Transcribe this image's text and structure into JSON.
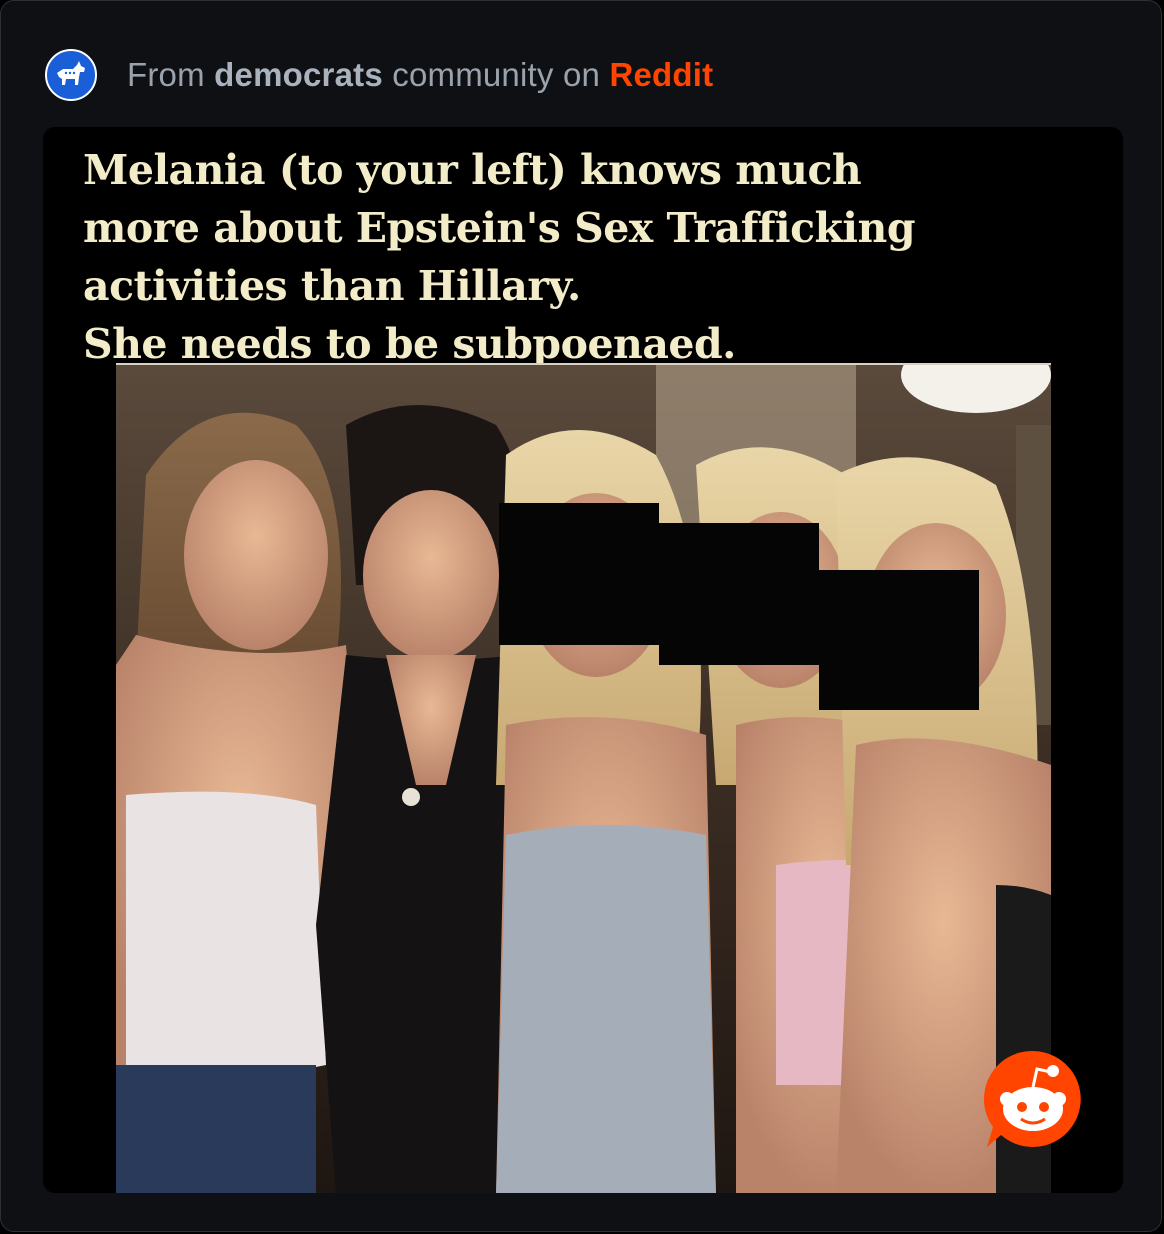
{
  "header": {
    "prefix": "From",
    "community": "democrats",
    "middle": "community on",
    "platform": "Reddit",
    "community_icon": "donkey-icon",
    "colors": {
      "platform": "#ff4500",
      "community_icon_bg": "#1a5fd8"
    }
  },
  "post": {
    "caption": "Melania (to your left) knows much\nmore about Epstein's Sex Trafficking\nactivities than Hillary.\nShe needs to be subpoenaed.",
    "watermark_icon": "reddit-snoo-icon"
  }
}
